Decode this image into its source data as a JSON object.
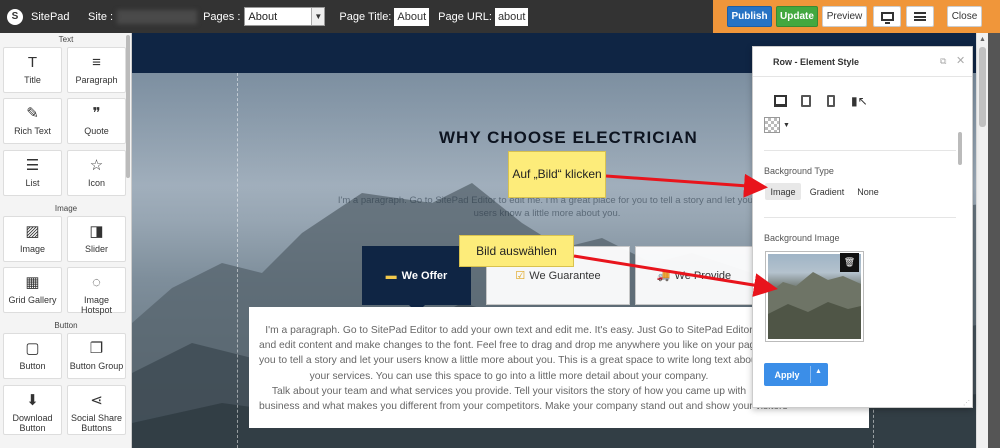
{
  "topbar": {
    "logo_glyph": "S",
    "app_name": "SitePad",
    "site_label": "Site :",
    "site_value": "sitepad-site",
    "pages_label": "Pages :",
    "pages_selected": "About",
    "page_title_label": "Page Title:",
    "page_title_value": "About",
    "page_url_label": "Page URL:",
    "page_url_value": "about",
    "publish": "Publish",
    "update": "Update",
    "preview": "Preview",
    "close": "Close",
    "accent_color": "#f0963a",
    "publish_color": "#2773c4",
    "update_color": "#43a83f"
  },
  "sidebar": {
    "sections": [
      {
        "title": "Text",
        "items": [
          {
            "label": "Title",
            "glyph": "T",
            "icon": "title-icon"
          },
          {
            "label": "Paragraph",
            "glyph": "≡",
            "icon": "paragraph-icon"
          },
          {
            "label": "Rich Text",
            "glyph": "✎",
            "icon": "rich-text-icon"
          },
          {
            "label": "Quote",
            "glyph": "❞",
            "icon": "quote-icon"
          },
          {
            "label": "List",
            "glyph": "☰",
            "icon": "list-icon"
          },
          {
            "label": "Icon",
            "glyph": "☆",
            "icon": "star-icon"
          }
        ]
      },
      {
        "title": "Image",
        "items": [
          {
            "label": "Image",
            "glyph": "▨",
            "icon": "image-icon"
          },
          {
            "label": "Slider",
            "glyph": "◨",
            "icon": "slider-icon"
          },
          {
            "label": "Grid Gallery",
            "glyph": "▦",
            "icon": "grid-gallery-icon"
          },
          {
            "label": "Image Hotspot",
            "glyph": "◌",
            "icon": "image-hotspot-icon"
          }
        ]
      },
      {
        "title": "Button",
        "items": [
          {
            "label": "Button",
            "glyph": "▢",
            "icon": "button-icon"
          },
          {
            "label": "Button Group",
            "glyph": "❐",
            "icon": "button-group-icon"
          },
          {
            "label": "Download Button",
            "glyph": "⬇",
            "icon": "download-icon"
          },
          {
            "label": "Social Share Buttons",
            "glyph": "⋖",
            "icon": "share-icon"
          }
        ]
      }
    ]
  },
  "canvas": {
    "heading": "WHY CHOOSE ELECTRICIAN",
    "hero_paragraph": "I'm a paragraph. Go to SitePad Editor to edit me. I'm a great place for you to tell a story and let your users know a little more about you.",
    "tabs": [
      {
        "label": "We Offer",
        "glyph": "▬",
        "icon": "offer-icon"
      },
      {
        "label": "We Guarantee",
        "glyph": "☑",
        "icon": "guarantee-icon"
      },
      {
        "label": "We Provide",
        "glyph": "🚚",
        "icon": "truck-icon"
      }
    ],
    "content_lines": [
      "I'm a paragraph. Go to SitePad Editor to add your own text and edit me. It's easy. Just Go to SitePad Editor",
      "and edit content and make changes to the font. Feel free to drag and drop me anywhere you like on your page.",
      "you to tell a story and let your users know a little more about you. This is a great space to write long text about",
      "your services. You can use this space to go into a little more detail about your company.",
      "Talk about your team and what services you provide. Tell your visitors the story of how you came up with",
      "business and what makes you different from your competitors. Make your company stand out and show your visitors"
    ],
    "navy_color": "#0f2544"
  },
  "callouts": {
    "first": "Auf „Bild“ klicken",
    "second": "Bild auswählen",
    "arrow_color": "#e8141c"
  },
  "panel": {
    "title": "Row - Element Style",
    "background_type_label": "Background Type",
    "options": [
      "Image",
      "Gradient",
      "None"
    ],
    "selected_option": "Image",
    "background_image_label": "Background Image",
    "apply": "Apply",
    "apply_color": "#3b8ee8"
  }
}
